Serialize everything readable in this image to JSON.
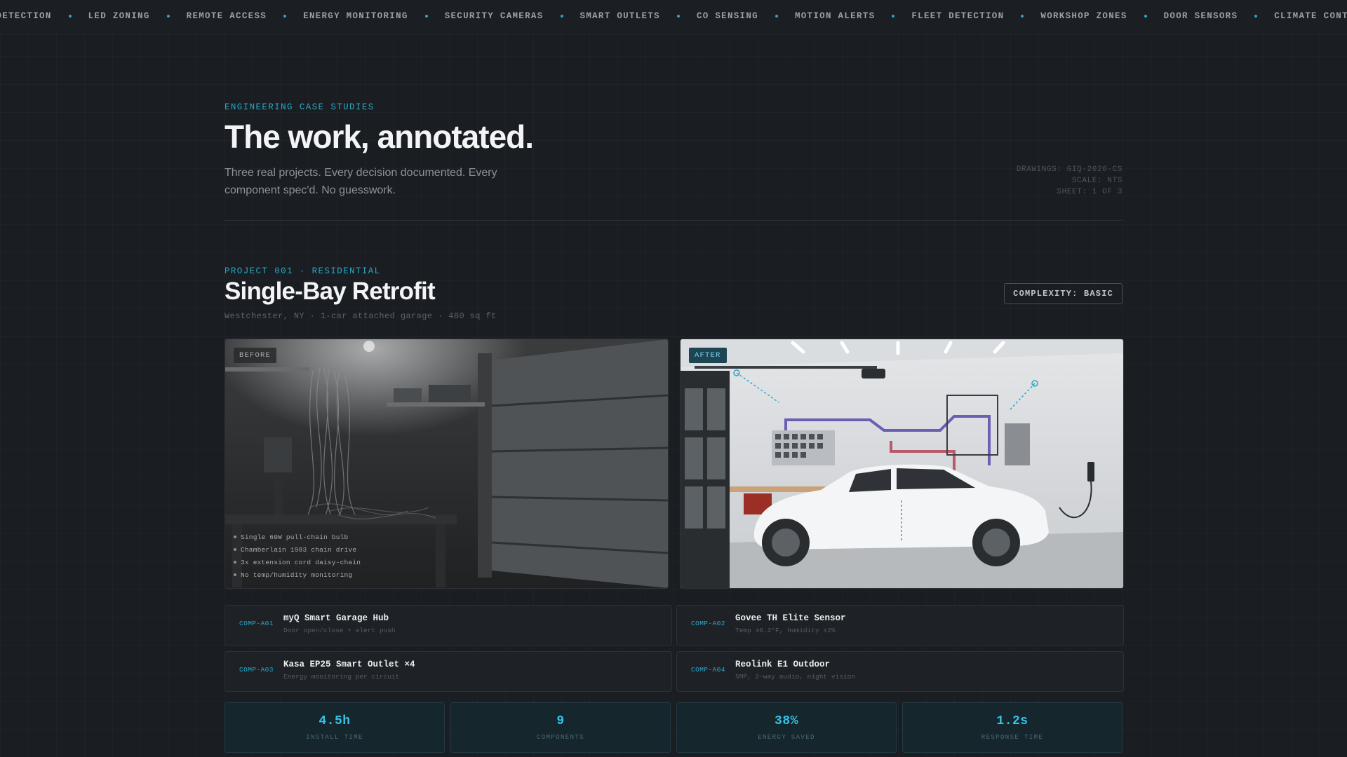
{
  "ticker": [
    "LE DETECTION",
    "LED ZONING",
    "REMOTE ACCESS",
    "ENERGY MONITORING",
    "SECURITY CAMERAS",
    "SMART OUTLETS",
    "CO SENSING",
    "MOTION ALERTS",
    "FLEET DETECTION",
    "WORKSHOP ZONES",
    "DOOR SENSORS",
    "CLIMATE CONTROL"
  ],
  "header": {
    "eyebrow": "ENGINEERING CASE STUDIES",
    "title": "The work, annotated.",
    "subtitle": "Three real projects. Every decision documented. Every component spec'd. No guesswork.",
    "drawing_meta": [
      "DRAWINGS: GIQ-2026-CS",
      "SCALE: NTS",
      "SHEET: 1 OF 3"
    ]
  },
  "project": {
    "label": "PROJECT 001 · RESIDENTIAL",
    "title": "Single-Bay Retrofit",
    "meta": "Westchester, NY · 1-car attached garage · 480 sq ft",
    "complexity": "COMPLEXITY: BASIC",
    "before_tag": "BEFORE",
    "after_tag": "AFTER",
    "before_notes": [
      "Single 60W pull-chain bulb",
      "Chamberlain 1983 chain drive",
      "3x extension cord daisy-chain",
      "No temp/humidity monitoring"
    ]
  },
  "components": [
    {
      "id": "COMP-A01",
      "name": "myQ Smart Garage Hub",
      "desc": "Door open/close + alert push"
    },
    {
      "id": "COMP-A02",
      "name": "Govee TH Elite Sensor",
      "desc": "Temp ±0.2°F, humidity ±2%"
    },
    {
      "id": "COMP-A03",
      "name": "Kasa EP25 Smart Outlet ×4",
      "desc": "Energy monitoring per circuit"
    },
    {
      "id": "COMP-A04",
      "name": "Reolink E1 Outdoor",
      "desc": "5MP, 2-way audio, night vision"
    }
  ],
  "stats": [
    {
      "value": "4.5h",
      "label": "INSTALL TIME"
    },
    {
      "value": "9",
      "label": "COMPONENTS"
    },
    {
      "value": "38%",
      "label": "ENERGY SAVED"
    },
    {
      "value": "1.2s",
      "label": "RESPONSE TIME"
    }
  ],
  "colors": {
    "accent": "#2aa8c7",
    "background": "#1a1d21",
    "stat_value": "#36c3e6"
  }
}
